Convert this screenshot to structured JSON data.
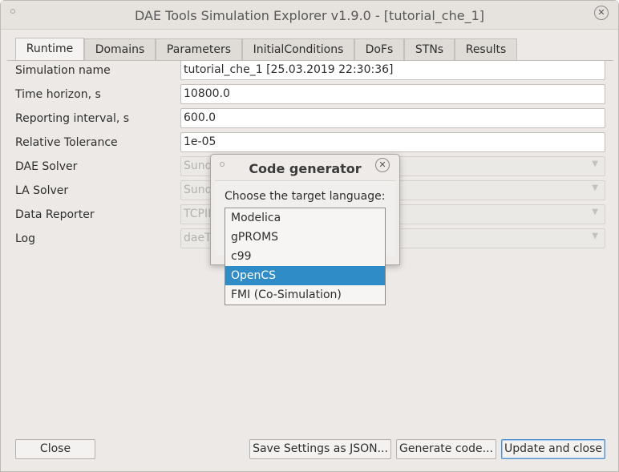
{
  "window": {
    "title": "DAE Tools Simulation Explorer v1.9.0 - [tutorial_che_1]",
    "close_icon": "close-icon"
  },
  "tabs": [
    {
      "label": "Runtime",
      "active": true
    },
    {
      "label": "Domains"
    },
    {
      "label": "Parameters"
    },
    {
      "label": "InitialConditions"
    },
    {
      "label": "DoFs"
    },
    {
      "label": "STNs"
    },
    {
      "label": "Results"
    }
  ],
  "runtime": {
    "rows": [
      {
        "label": "Simulation name",
        "value": "tutorial_che_1 [25.03.2019 22:30:36]"
      },
      {
        "label": "Time horizon, s",
        "value": "10800.0"
      },
      {
        "label": "Reporting interval, s",
        "value": "600.0"
      },
      {
        "label": "Relative Tolerance",
        "value": "1e-05"
      },
      {
        "label": "DAE Solver",
        "value": "Sund"
      },
      {
        "label": "LA Solver",
        "value": "Sund"
      },
      {
        "label": "Data Reporter",
        "value": "TCPIP"
      },
      {
        "label": "Log",
        "value": "daeT"
      }
    ]
  },
  "buttons": {
    "close": "Close",
    "save_settings": "Save Settings as JSON...",
    "generate_code": "Generate code...",
    "update_and_close": "Update and close"
  },
  "dialog": {
    "title": "Code generator",
    "prompt": "Choose the target language:",
    "options": [
      "Modelica",
      "gPROMS",
      "c99",
      "OpenCS",
      "FMI (Co-Simulation)"
    ],
    "selected": "OpenCS"
  },
  "colors": {
    "selection": "#308cc6",
    "window_bg": "#ece9e6",
    "focus_border": "#4f8fcf"
  }
}
